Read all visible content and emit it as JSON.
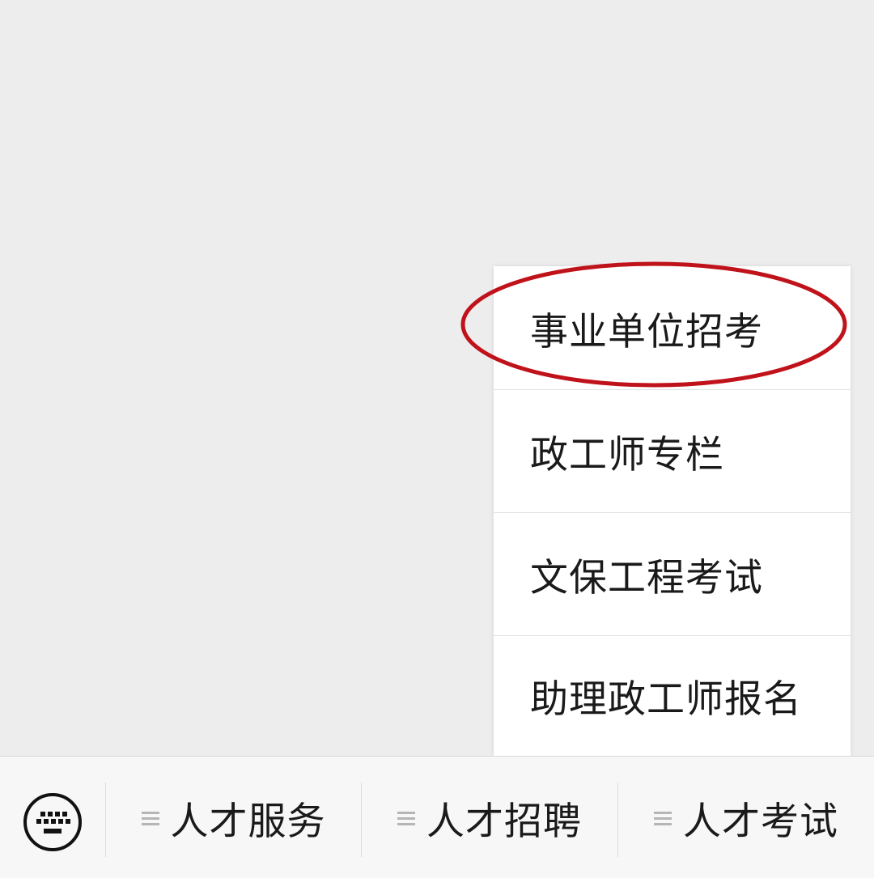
{
  "submenu": {
    "items": [
      {
        "label": "事业单位招考",
        "highlighted": true
      },
      {
        "label": "政工师专栏"
      },
      {
        "label": "文保工程考试"
      },
      {
        "label": "助理政工师报名"
      }
    ],
    "highlight_color": "#C0121A"
  },
  "bottom_bar": {
    "keyboard_icon": "keyboard-icon",
    "menus": [
      {
        "label": "人才服务",
        "icon": "menu-lines-icon"
      },
      {
        "label": "人才招聘",
        "icon": "menu-lines-icon"
      },
      {
        "label": "人才考试",
        "icon": "menu-lines-icon"
      }
    ]
  }
}
